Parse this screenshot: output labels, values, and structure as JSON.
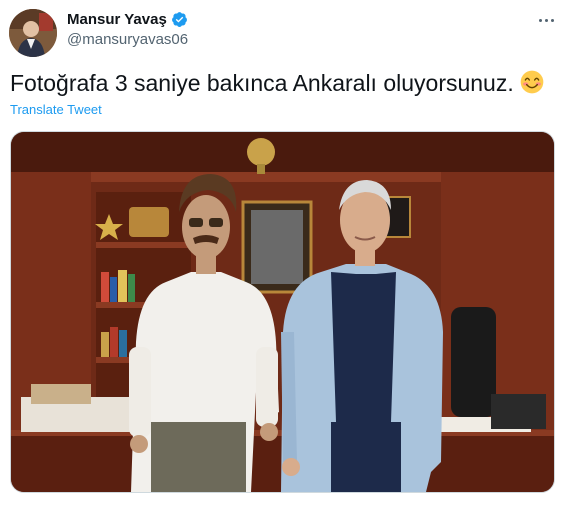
{
  "author": {
    "display_name": "Mansur Yavaş",
    "handle": "@mansuryavas06",
    "verified": true,
    "avatar_icon": "profile-photo"
  },
  "tweet": {
    "text": "Fotoğrafa 3 saniye bakınca Ankaralı oluyorsunuz.",
    "emoji": "smiling-face-with-smiling-eyes",
    "translate_label": "Translate Tweet"
  },
  "menu": {
    "icon": "more-horizontal-icon"
  },
  "media": {
    "type": "photo",
    "subject": "two-men-standing-in-office"
  },
  "colors": {
    "accent": "#1d9bf0",
    "text": "#0f1419",
    "secondary_text": "#536471",
    "border": "#cfd9de"
  }
}
